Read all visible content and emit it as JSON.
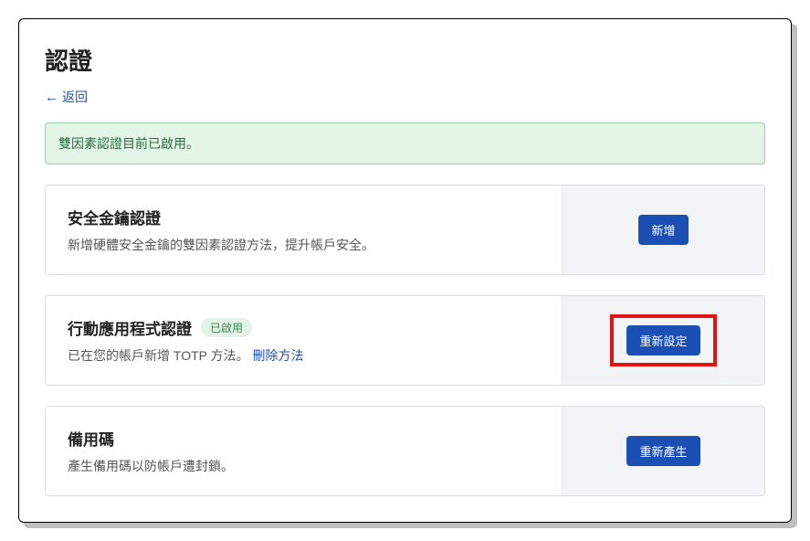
{
  "page": {
    "title": "認證"
  },
  "nav": {
    "back": "返回"
  },
  "alert": {
    "text": "雙因素認證目前已啟用。"
  },
  "security_key": {
    "title": "安全金鑰認證",
    "desc": "新增硬體安全金鑰的雙因素認證方法，提升帳戶安全。",
    "action": "新增"
  },
  "totp": {
    "title": "行動應用程式認證",
    "badge": "已啟用",
    "desc_prefix": "已在您的帳戶新增 TOTP 方法。",
    "remove_link": "刪除方法",
    "action": "重新設定"
  },
  "backup": {
    "title": "備用碼",
    "desc": "產生備用碼以防帳戶遭封鎖。",
    "action": "重新產生"
  }
}
